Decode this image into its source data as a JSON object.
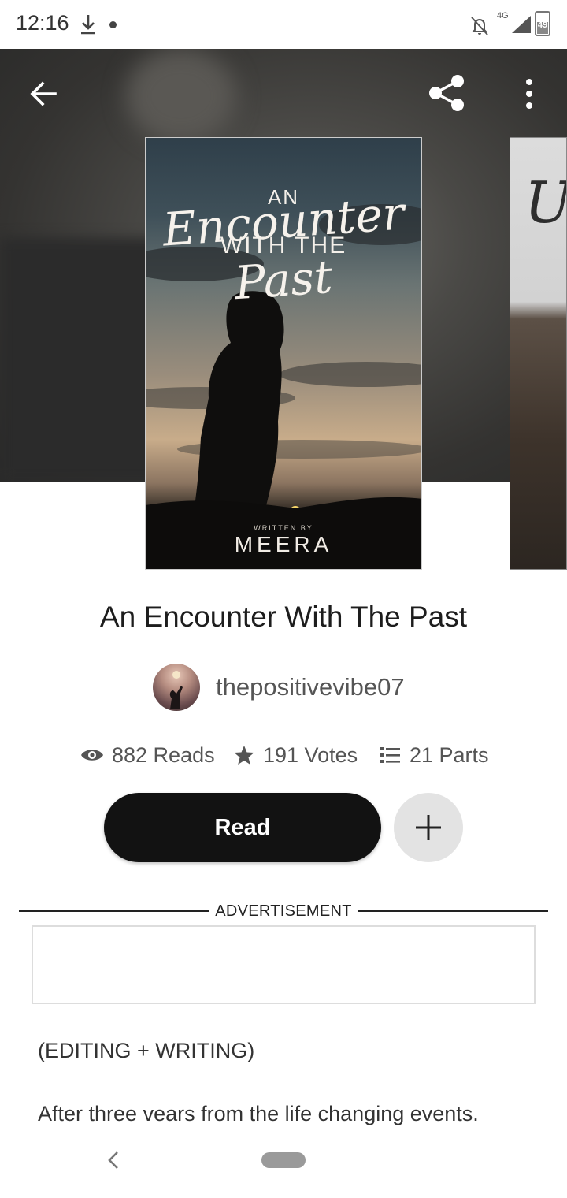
{
  "status_bar": {
    "time": "12:16",
    "network": "4G",
    "battery": "49"
  },
  "header": {
    "back_icon": "arrow-left-icon",
    "share_icon": "share-icon",
    "more_icon": "more-vertical-icon"
  },
  "cover": {
    "title_an": "AN",
    "title_encounter": "Encounter",
    "title_with_the": "WITH THE",
    "title_past": "Past",
    "written_by": "WRITTEN BY",
    "author": "MEERA"
  },
  "next_cover": {
    "visible_letter": "U"
  },
  "book": {
    "title": "An Encounter With The Past",
    "author_username": "thepositivevibe07",
    "stats": {
      "reads": "882 Reads",
      "votes": "191 Votes",
      "parts": "21 Parts"
    },
    "read_label": "Read",
    "add_icon": "plus-icon"
  },
  "advertisement": {
    "label": "ADVERTISEMENT"
  },
  "description": {
    "line1": "(EDITING + WRITING)",
    "line2": "After three vears from the life changing events."
  },
  "colors": {
    "primary_button": "#121212",
    "secondary_button": "#e3e3e3",
    "text": "#1d1d1d"
  }
}
